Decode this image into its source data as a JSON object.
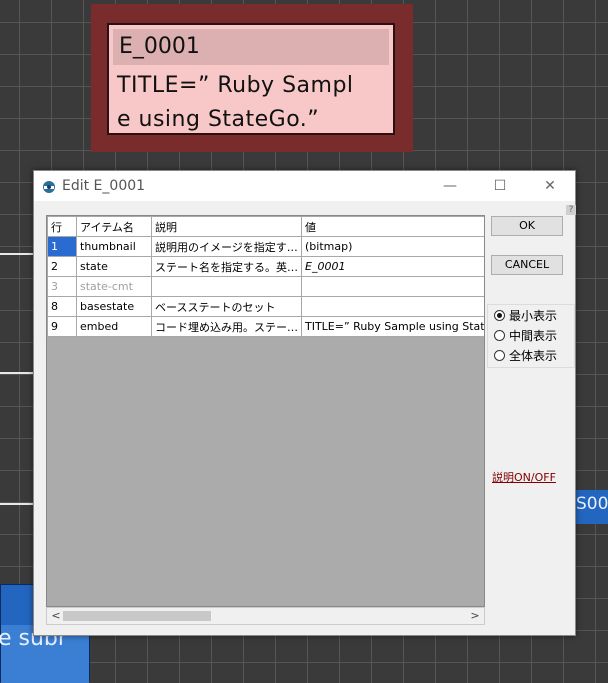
{
  "canvas": {
    "node_title": "E_0001",
    "node_body_line1": "TITLE=” Ruby Sampl",
    "node_body_line2": "e  using StateGo.”",
    "blue_node_text": "e subr",
    "right_node_text": "S00"
  },
  "dialog": {
    "title": "Edit E_0001",
    "minimize_glyph": "—",
    "maximize_glyph": "☐",
    "close_glyph": "✕",
    "help_glyph": "?",
    "columns": [
      "行",
      "アイテム名",
      "説明",
      "値"
    ],
    "rows": [
      {
        "num": "1",
        "name": "thumbnail",
        "desc": "説明用のイメージを指定する。",
        "value": "(bitmap)"
      },
      {
        "num": "2",
        "name": "state",
        "desc": "ステート名を指定する。英文…",
        "value": "E_0001"
      },
      {
        "num": "3",
        "name": "state-cmt",
        "desc": "",
        "value": ""
      },
      {
        "num": "8",
        "name": "basestate",
        "desc": "ベースステートのセット",
        "value": ""
      },
      {
        "num": "9",
        "name": "embed",
        "desc": "コード埋め込み用。ステート…",
        "value": "TITLE=” Ruby Sample using StateGo.”"
      }
    ],
    "ok_label": "OK",
    "cancel_label": "CANCEL",
    "view_modes": [
      {
        "label": "最小表示",
        "selected": true
      },
      {
        "label": "中間表示",
        "selected": false
      },
      {
        "label": "全体表示",
        "selected": false
      }
    ],
    "desc_toggle_label": "説明ON/OFF",
    "scroll_left": "<",
    "scroll_right": ">",
    "colors": {
      "selection": "#2a6bd1",
      "link": "#800000",
      "node_fill": "#f8c8c8"
    }
  }
}
